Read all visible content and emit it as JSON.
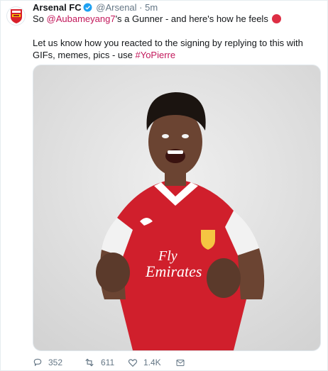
{
  "tweet": {
    "author_name": "Arsenal FC",
    "author_handle": "@Arsenal",
    "separator": "·",
    "time": "5m",
    "line1_prefix": "So ",
    "line1_mention": "@Aubameyang7",
    "line1_suffix": "'s a Gunner - and here's how he feels",
    "line2_prefix": "Let us know how you reacted to the signing by replying to this with GIFs, memes, pics - use ",
    "line2_hashtag": "#YoPierre"
  },
  "actions": {
    "reply_count": "352",
    "retweet_count": "611",
    "like_count": "1.4K"
  },
  "media": {
    "logo_text": "Fly Emirates",
    "logo_parts": [
      "Fly",
      "Emirates"
    ]
  },
  "colors": {
    "link": "#c2185b",
    "red_dot": "#dd2e44",
    "muted": "#657786",
    "verified": "#1da1f2",
    "arsenal_red": "#cc1f2f",
    "background_photo": "#e3e3e3"
  },
  "icons": [
    "arsenal-crest-icon",
    "verified-badge-icon",
    "red-circle-emoji-icon",
    "reply-icon",
    "retweet-icon",
    "like-icon",
    "direct-message-icon"
  ]
}
